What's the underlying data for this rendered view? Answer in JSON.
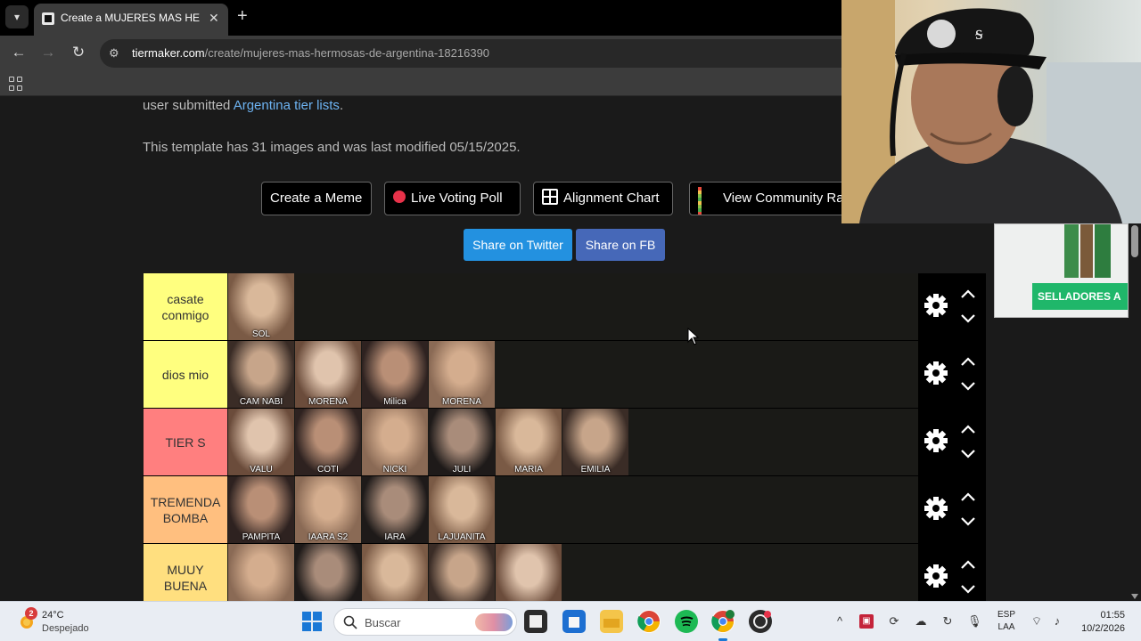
{
  "browser": {
    "tab_title": "Create a MUJERES MAS HERMOSAS DE ARGENTINA",
    "url_host": "tiermaker.com",
    "url_path": "/create/mujeres-mas-hermosas-de-argentina-18216390"
  },
  "page": {
    "intro_prefix": "user submitted ",
    "intro_link": "Argentina tier lists",
    "intro_suffix": ".",
    "template_info": "This template has 31 images and was last modified 05/15/2025."
  },
  "actions": {
    "meme": "Create a Meme",
    "poll": "Live Voting Poll",
    "alignment": "Alignment Chart",
    "community": "View Community Rankings"
  },
  "share": {
    "twitter": "Share on Twitter",
    "fb": "Share on FB"
  },
  "colors": {
    "twitter": "#2391e0",
    "fb": "#4668b8",
    "poll_dot": "#e8324a"
  },
  "tiers": [
    {
      "label": "casate conmigo",
      "color": "#ffff7f",
      "items": [
        "SOL"
      ]
    },
    {
      "label": "dios mio",
      "color": "#ffff7f",
      "items": [
        "CAM NABI",
        "MORENA",
        "Milica",
        "MORENA"
      ]
    },
    {
      "label": "TIER S",
      "color": "#ff7f7f",
      "items": [
        "VALU",
        "COTI",
        "NICKI",
        "JULI",
        "MARIA",
        "EMILIA"
      ]
    },
    {
      "label": "TREMENDA BOMBA",
      "color": "#ffbf7f",
      "items": [
        "PAMPITA",
        "IAARA S2",
        "IARA",
        "LAJUANITA"
      ]
    },
    {
      "label": "MUUY BUENA",
      "color": "#ffdf7f",
      "items": [
        "",
        "",
        "",
        "",
        ""
      ]
    }
  ],
  "ad": {
    "banner": "SELLADORES A"
  },
  "taskbar": {
    "notification_count": "2",
    "temperature": "24°C",
    "weather": "Despejado",
    "search_placeholder": "Buscar",
    "lang_1": "ESP",
    "lang_2": "LAA",
    "time": "01:55",
    "date": "10/2/2026"
  }
}
